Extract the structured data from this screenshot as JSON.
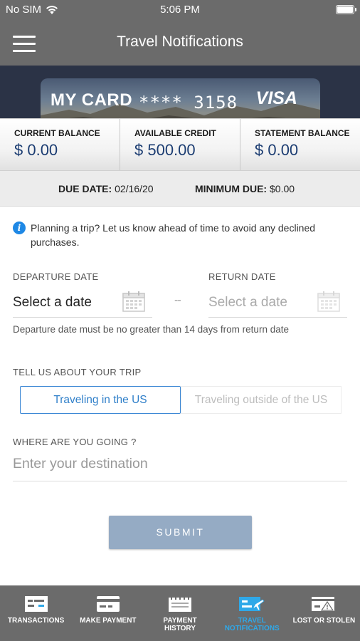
{
  "status_bar": {
    "carrier": "No SIM",
    "time": "5:06 PM"
  },
  "nav": {
    "title": "Travel Notifications"
  },
  "card": {
    "name": "MY CARD",
    "number": "**** 3158",
    "network": "VISA"
  },
  "balances": [
    {
      "label": "CURRENT BALANCE",
      "value": "$ 0.00"
    },
    {
      "label": "AVAILABLE CREDIT",
      "value": "$ 500.00"
    },
    {
      "label": "STATEMENT BALANCE",
      "value": "$ 0.00"
    }
  ],
  "due": {
    "due_date_label": "DUE DATE:",
    "due_date_value": "02/16/20",
    "minimum_due_label": "MINIMUM DUE:",
    "minimum_due_value": "$0.00"
  },
  "info": {
    "text": "Planning a trip? Let us know ahead of time to avoid any declined purchases."
  },
  "dates": {
    "departure_label": "DEPARTURE DATE",
    "departure_value": "Select a date",
    "return_label": "RETURN DATE",
    "return_value": "Select a date",
    "separator": "--",
    "hint": "Departure date must be no greater than 14 days from return date"
  },
  "trip": {
    "label": "TELL US ABOUT YOUR TRIP",
    "option_us": "Traveling in the US",
    "option_outside": "Traveling outside of the US",
    "selected": "Traveling in the US"
  },
  "destination": {
    "label": "WHERE ARE YOU GOING ?",
    "placeholder": "Enter your destination"
  },
  "submit": {
    "label": "SUBMIT"
  },
  "tabs": [
    {
      "label": "TRANSACTIONS",
      "icon": "transactions-icon"
    },
    {
      "label": "MAKE PAYMENT",
      "icon": "payment-card-icon"
    },
    {
      "label": "PAYMENT HISTORY",
      "icon": "payment-history-icon"
    },
    {
      "label": "TRAVEL NOTIFICATIONS",
      "icon": "travel-notifications-icon",
      "active": true
    },
    {
      "label": "LOST OR STOLEN",
      "icon": "lost-stolen-icon"
    }
  ],
  "colors": {
    "accent": "#2fa8e8",
    "balance_text": "#1c3d72",
    "header_bg": "#6b6b6b",
    "submit_bg": "#95abc4"
  }
}
